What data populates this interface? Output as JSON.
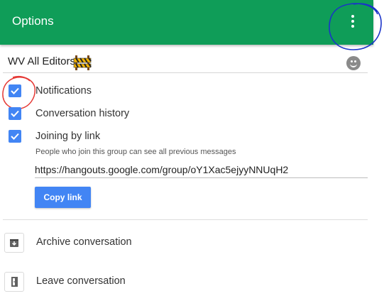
{
  "header": {
    "title": "Options",
    "background": "#0f9d58",
    "menu_icon": "more-vert-icon"
  },
  "conversation_name": {
    "value": "WV All Editors",
    "decoration_icon": "construction-sign-icon",
    "emoji_icon": "smiley-face-icon"
  },
  "options": [
    {
      "label": "Notifications",
      "checked": true
    },
    {
      "label": "Conversation history",
      "checked": true
    },
    {
      "label": "Joining by link",
      "checked": true
    }
  ],
  "link_section": {
    "help_text": "People who join this group can see all previous messages",
    "url": "https://hangouts.google.com/group/oY1Xac5ejyyNNUqH2",
    "copy_label": "Copy link"
  },
  "actions": [
    {
      "label": "Archive conversation",
      "icon": "archive-icon"
    },
    {
      "label": "Leave conversation",
      "icon": "exit-icon"
    }
  ],
  "colors": {
    "accent": "#4285f4",
    "annotation_red": "#e53935",
    "annotation_blue": "#1a33c9"
  }
}
